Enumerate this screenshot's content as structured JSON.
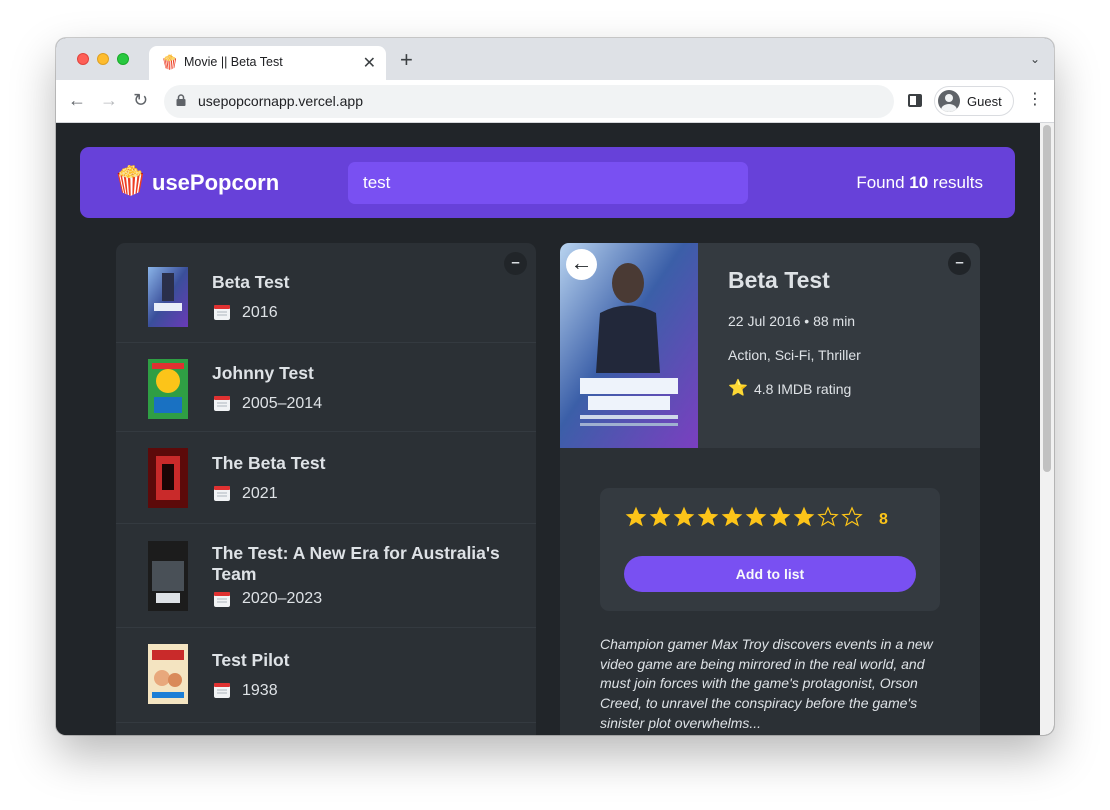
{
  "browser": {
    "tab_title": "Movie || Beta Test",
    "tab_favicon": "🍿",
    "tab_close": "✕",
    "new_tab": "+",
    "tab_menu": "⌄",
    "url": "usepopcornapp.vercel.app",
    "back": "←",
    "forward": "→",
    "reload": "↻",
    "profile_name": "Guest",
    "menu": "⋮"
  },
  "app": {
    "logo_icon": "🍿",
    "logo_text": "usePopcorn",
    "search_value": "test",
    "results_prefix": "Found ",
    "results_count": "10",
    "results_suffix": " results",
    "brand_color": "#6741d9",
    "accent_color": "#7950f2"
  },
  "list": {
    "toggle_label": "–",
    "movies": [
      {
        "title": "Beta Test",
        "year": "2016"
      },
      {
        "title": "Johnny Test",
        "year": "2005–2014"
      },
      {
        "title": "The Beta Test",
        "year": "2021"
      },
      {
        "title": "The Test: A New Era for Australia's Team",
        "year": "2020–2023"
      },
      {
        "title": "Test Pilot",
        "year": "1938"
      }
    ]
  },
  "details": {
    "toggle_label": "–",
    "back_label": "←",
    "title": "Beta Test",
    "released_runtime": "22 Jul 2016 • 88 min",
    "genre": "Action, Sci-Fi, Thriller",
    "star_icon": "⭐",
    "imdb_rating": "4.8 IMDB rating",
    "user_rating": "8",
    "user_rating_value": 8,
    "max_rating": 10,
    "add_button": "Add to list",
    "plot": "Champion gamer Max Troy discovers events in a new video game are being mirrored in the real world, and must join forces with the game's protagonist, Orson Creed, to unravel the conspiracy before the game's sinister plot overwhelms..."
  }
}
